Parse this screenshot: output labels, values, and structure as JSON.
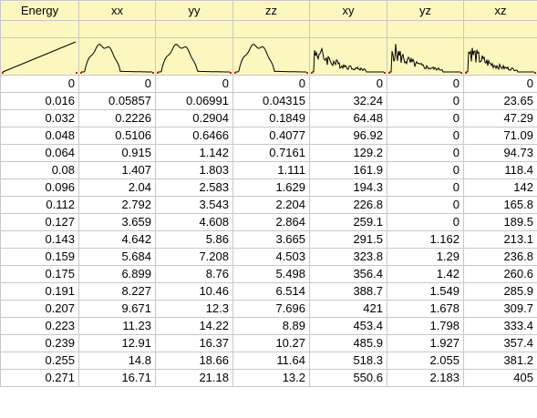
{
  "columns": [
    "Energy",
    "xx",
    "yy",
    "zz",
    "xy",
    "yz",
    "xz"
  ],
  "rows": [
    [
      "0",
      "0",
      "0",
      "0",
      "0",
      "0",
      "0"
    ],
    [
      "0.016",
      "0.05857",
      "0.06991",
      "0.04315",
      "32.24",
      "0",
      "23.65"
    ],
    [
      "0.032",
      "0.2226",
      "0.2904",
      "0.1849",
      "64.48",
      "0",
      "47.29"
    ],
    [
      "0.048",
      "0.5106",
      "0.6466",
      "0.4077",
      "96.92",
      "0",
      "71.09"
    ],
    [
      "0.064",
      "0.915",
      "1.142",
      "0.7161",
      "129.2",
      "0",
      "94.73"
    ],
    [
      "0.08",
      "1.407",
      "1.803",
      "1.111",
      "161.9",
      "0",
      "118.4"
    ],
    [
      "0.096",
      "2.04",
      "2.583",
      "1.629",
      "194.3",
      "0",
      "142"
    ],
    [
      "0.112",
      "2.792",
      "3.543",
      "2.204",
      "226.8",
      "0",
      "165.8"
    ],
    [
      "0.127",
      "3.659",
      "4.608",
      "2.864",
      "259.1",
      "0",
      "189.5"
    ],
    [
      "0.143",
      "4.642",
      "5.86",
      "3.665",
      "291.5",
      "1.162",
      "213.1"
    ],
    [
      "0.159",
      "5.684",
      "7.208",
      "4.503",
      "323.8",
      "1.29",
      "236.8"
    ],
    [
      "0.175",
      "6.899",
      "8.76",
      "5.498",
      "356.4",
      "1.42",
      "260.6"
    ],
    [
      "0.191",
      "8.227",
      "10.46",
      "6.514",
      "388.7",
      "1.549",
      "285.9"
    ],
    [
      "0.207",
      "9.671",
      "12.3",
      "7.696",
      "421",
      "1.678",
      "309.7"
    ],
    [
      "0.223",
      "11.23",
      "14.22",
      "8.89",
      "453.4",
      "1.798",
      "333.4"
    ],
    [
      "0.239",
      "12.91",
      "16.37",
      "10.27",
      "485.9",
      "1.927",
      "357.4"
    ],
    [
      "0.255",
      "14.8",
      "18.66",
      "11.64",
      "518.3",
      "2.055",
      "381.2"
    ],
    [
      "0.271",
      "16.71",
      "21.18",
      "13.2",
      "550.6",
      "2.183",
      "405"
    ]
  ],
  "sparklines": [
    {
      "kind": "ramp"
    },
    {
      "kind": "peak",
      "seed": 1
    },
    {
      "kind": "peak",
      "seed": 2
    },
    {
      "kind": "peak",
      "seed": 3
    },
    {
      "kind": "spiky",
      "seed": 4
    },
    {
      "kind": "spiky",
      "seed": 5
    },
    {
      "kind": "spiky",
      "seed": 6
    }
  ],
  "colors": {
    "header_bg": "#fbf7bf",
    "grid": "#c8c8c8",
    "marker": "#cc2200"
  }
}
